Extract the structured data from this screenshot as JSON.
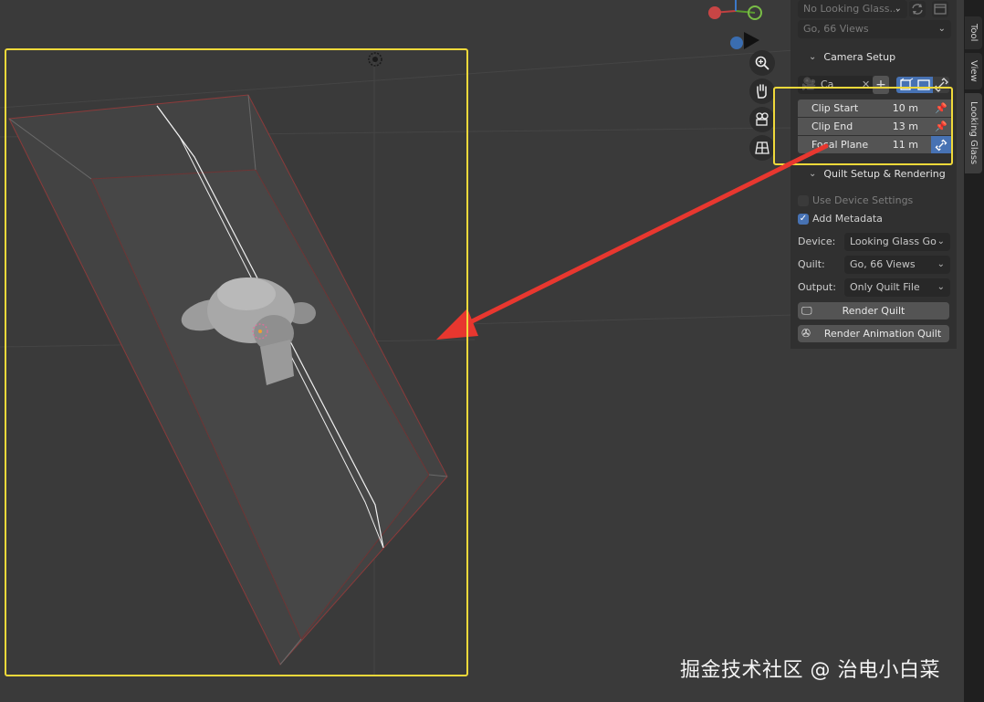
{
  "npanel": {
    "display_dropdown": "No Looking Glass...",
    "display_views": "Go, 66 Views",
    "camera_section": "Camera Setup",
    "camera_name": "Ca",
    "clip_start": {
      "label": "Clip Start",
      "value": "10 m"
    },
    "clip_end": {
      "label": "Clip End",
      "value": "13 m"
    },
    "focal_plane": {
      "label": "Focal Plane",
      "value": "11 m"
    },
    "quilt_section": "Quilt Setup & Rendering",
    "use_device_settings": {
      "label": "Use Device Settings",
      "checked": false
    },
    "add_metadata": {
      "label": "Add Metadata",
      "checked": true
    },
    "device": {
      "label": "Device:",
      "value": "Looking Glass Go"
    },
    "quilt": {
      "label": "Quilt:",
      "value": "Go, 66 Views"
    },
    "output": {
      "label": "Output:",
      "value": "Only Quilt File"
    },
    "render_quilt": "Render Quilt",
    "render_animation_quilt": "Render Animation Quilt"
  },
  "tabs": [
    "Tool",
    "View",
    "Looking Glass"
  ],
  "watermark": "掘金技术社区 @ 治电小白菜",
  "colors": {
    "accent_blue": "#4772b3",
    "highlight_yellow": "#f0d93a",
    "arrow_red": "#e8372f",
    "viewport_bg": "#3a3a3a",
    "panel_bg": "#303030"
  },
  "icons": {
    "zoom": "magnifier-plus-icon",
    "pan": "hand-icon",
    "camera_view": "camera-icon",
    "ortho": "grid-icon",
    "refresh": "refresh-icon",
    "window": "window-icon",
    "pin": "pin-icon",
    "link": "link-icon",
    "render": "render-icon",
    "film": "film-reel-icon"
  }
}
